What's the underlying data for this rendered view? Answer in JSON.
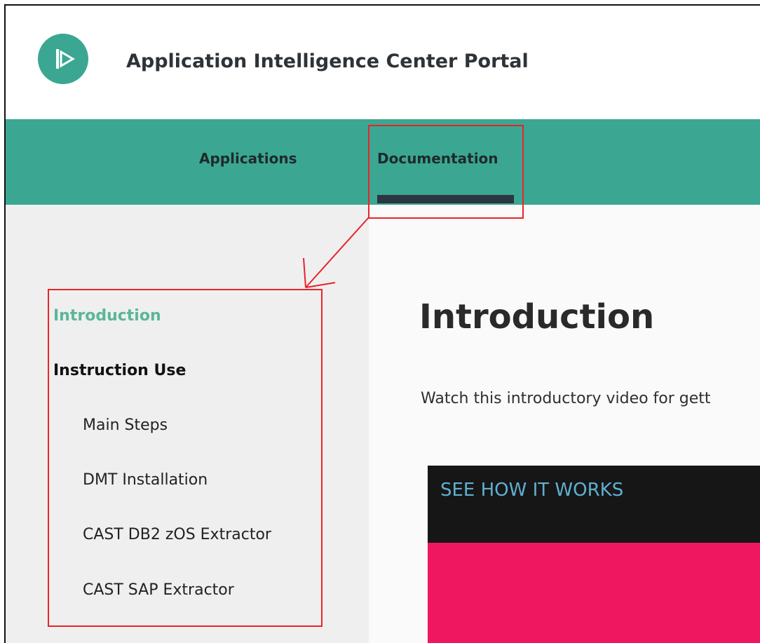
{
  "header": {
    "app_title": "Application Intelligence Center Portal",
    "logo_icon": "play-logo-icon"
  },
  "nav": {
    "tabs": [
      {
        "label": "Applications",
        "active": false
      },
      {
        "label": "Documentation",
        "active": true
      }
    ]
  },
  "sidebar": {
    "items": [
      {
        "label": "Introduction",
        "state": "active"
      },
      {
        "label": "Instruction Use",
        "state": "section"
      },
      {
        "label": "Main Steps",
        "state": "sub"
      },
      {
        "label": "DMT Installation",
        "state": "sub"
      },
      {
        "label": "CAST DB2 zOS Extractor",
        "state": "sub"
      },
      {
        "label": "CAST SAP Extractor",
        "state": "sub"
      }
    ]
  },
  "main": {
    "title": "Introduction",
    "intro_text": "Watch this introductory video for gett",
    "video": {
      "caption": "SEE HOW IT WORKS"
    }
  },
  "colors": {
    "brand_green": "#3ba792",
    "active_link": "#5bb69a",
    "active_bar": "#2b3640",
    "video_caption": "#5fb0d1",
    "video_accent": "#ee1760",
    "annotation_red": "#e8242a"
  }
}
